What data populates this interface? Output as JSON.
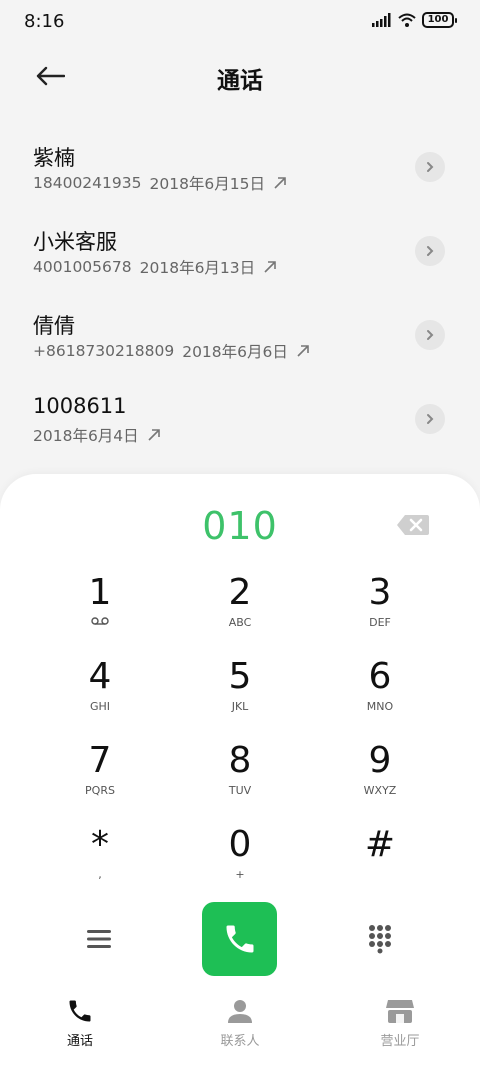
{
  "status_bar": {
    "time": "8:16",
    "battery": "100"
  },
  "header": {
    "title": "通话",
    "back_icon": "arrow-left-icon"
  },
  "calls": [
    {
      "name": "紫楠",
      "number": "18400241935",
      "date": "2018年6月15日",
      "direction": "outgoing"
    },
    {
      "name": "小米客服",
      "number": "4001005678",
      "date": "2018年6月13日",
      "direction": "outgoing"
    },
    {
      "name": "倩倩",
      "number": "+8618730218809",
      "date": "2018年6月6日",
      "direction": "outgoing"
    },
    {
      "name": "1008611",
      "number": "",
      "date": "2018年6月4日",
      "direction": "outgoing"
    }
  ],
  "dialer": {
    "input_value": "010",
    "accent_color": "#3ec26a",
    "call_button_color": "#1ebf55",
    "keys": [
      {
        "digit": "1",
        "letters": ""
      },
      {
        "digit": "2",
        "letters": "ABC"
      },
      {
        "digit": "3",
        "letters": "DEF"
      },
      {
        "digit": "4",
        "letters": "GHI"
      },
      {
        "digit": "5",
        "letters": "JKL"
      },
      {
        "digit": "6",
        "letters": "MNO"
      },
      {
        "digit": "7",
        "letters": "PQRS"
      },
      {
        "digit": "8",
        "letters": "TUV"
      },
      {
        "digit": "9",
        "letters": "WXYZ"
      },
      {
        "digit": "*",
        "letters": ","
      },
      {
        "digit": "0",
        "letters": "+"
      },
      {
        "digit": "#",
        "letters": ""
      }
    ]
  },
  "nav": {
    "items": [
      {
        "label": "通话",
        "icon": "phone-icon",
        "active": true
      },
      {
        "label": "联系人",
        "icon": "person-icon",
        "active": false
      },
      {
        "label": "营业厅",
        "icon": "store-icon",
        "active": false
      }
    ]
  }
}
